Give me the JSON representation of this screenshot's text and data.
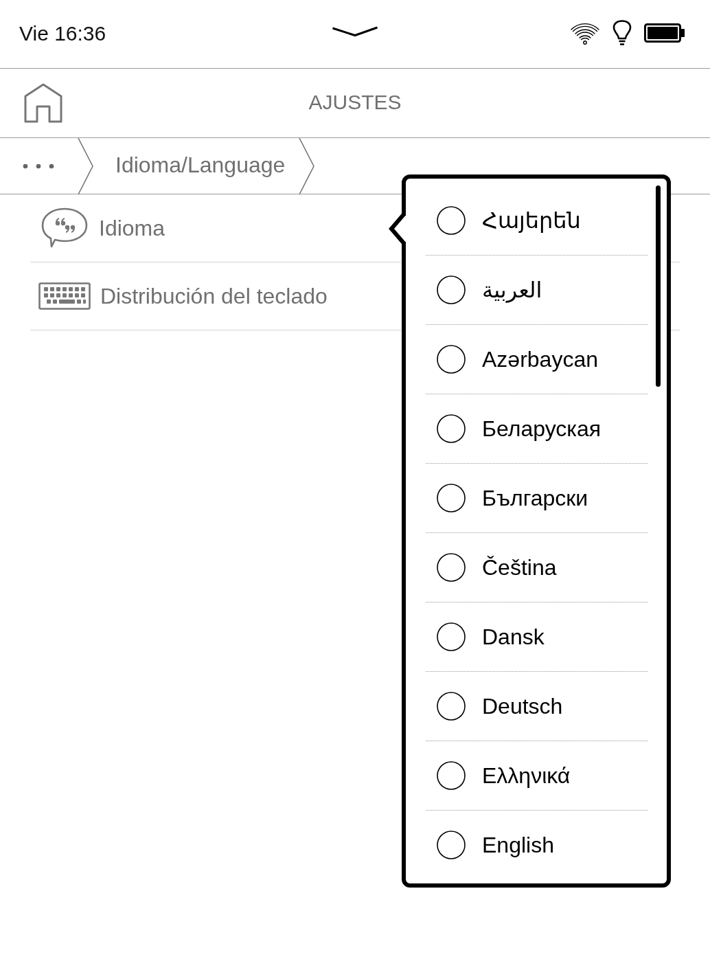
{
  "status_bar": {
    "time": "Vie 16:36"
  },
  "header": {
    "title": "AJUSTES"
  },
  "breadcrumb": {
    "items": [
      "Idioma/Language"
    ]
  },
  "settings_list": [
    {
      "kind": "language",
      "label": "Idioma"
    },
    {
      "kind": "keyboard",
      "label": "Distribución del teclado"
    }
  ],
  "language_popup": {
    "options": [
      {
        "label": "Հայերեն",
        "selected": false
      },
      {
        "label": "العربية",
        "selected": false
      },
      {
        "label": "Azərbaycan",
        "selected": false
      },
      {
        "label": "Беларуская",
        "selected": false
      },
      {
        "label": "Български",
        "selected": false
      },
      {
        "label": "Čeština",
        "selected": false
      },
      {
        "label": "Dansk",
        "selected": false
      },
      {
        "label": "Deutsch",
        "selected": false
      },
      {
        "label": "Ελληνικά",
        "selected": false
      },
      {
        "label": "English",
        "selected": false
      }
    ]
  }
}
